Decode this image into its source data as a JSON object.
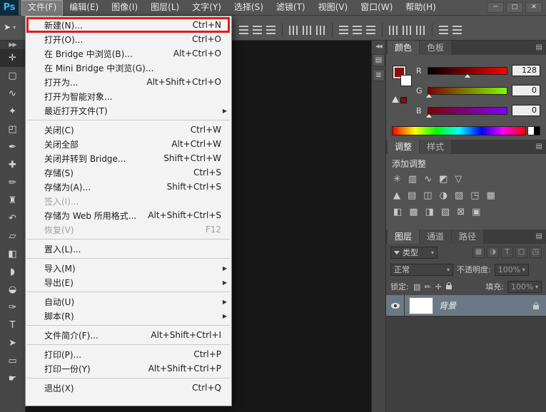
{
  "titlebar": {
    "logo_text": "Ps",
    "menus": [
      "文件(F)",
      "编辑(E)",
      "图像(I)",
      "图层(L)",
      "文字(Y)",
      "选择(S)",
      "滤镜(T)",
      "视图(V)",
      "窗口(W)",
      "帮助(H)"
    ],
    "active_menu_index": 0,
    "window_controls": [
      {
        "name": "minimize",
        "glyph": "─"
      },
      {
        "name": "maximize",
        "glyph": "▢"
      },
      {
        "name": "close",
        "glyph": "✕"
      }
    ]
  },
  "options_bar": {
    "tool_glyph": "➤",
    "dropdown_glyph": "▾",
    "groups": [
      {
        "icons": [
          "align-top-edges",
          "align-vertical-centers",
          "align-bottom-edges"
        ]
      },
      {
        "icons": [
          "align-left-edges",
          "align-horizontal-centers",
          "align-right-edges"
        ]
      },
      {
        "icons": [
          "distribute-top-edges",
          "distribute-vertical-centers",
          "distribute-bottom-edges"
        ]
      },
      {
        "icons": [
          "distribute-left-edges",
          "distribute-horizontal-centers",
          "distribute-right-edges"
        ]
      },
      {
        "icons": [
          "auto-align-layers",
          "3d-mode"
        ]
      }
    ]
  },
  "file_menu": {
    "items": [
      {
        "id": "new",
        "label": "新建(N)...",
        "shortcut": "Ctrl+N",
        "annotated": true
      },
      {
        "id": "open",
        "label": "打开(O)...",
        "shortcut": "Ctrl+O"
      },
      {
        "id": "browse-in-bridge",
        "label": "在 Bridge 中浏览(B)...",
        "shortcut": "Alt+Ctrl+O"
      },
      {
        "id": "browse-in-mini-bridge",
        "label": "在 Mini Bridge 中浏览(G)..."
      },
      {
        "id": "open-as",
        "label": "打开为...",
        "shortcut": "Alt+Shift+Ctrl+O"
      },
      {
        "id": "open-as-smart-object",
        "label": "打开为智能对象..."
      },
      {
        "id": "open-recent",
        "label": "最近打开文件(T)",
        "submenu": true,
        "separator_after": true
      },
      {
        "id": "close",
        "label": "关闭(C)",
        "shortcut": "Ctrl+W"
      },
      {
        "id": "close-all",
        "label": "关闭全部",
        "shortcut": "Alt+Ctrl+W"
      },
      {
        "id": "close-and-go-to-bridge",
        "label": "关闭并转到 Bridge...",
        "shortcut": "Shift+Ctrl+W"
      },
      {
        "id": "save",
        "label": "存储(S)",
        "shortcut": "Ctrl+S"
      },
      {
        "id": "save-as",
        "label": "存储为(A)...",
        "shortcut": "Shift+Ctrl+S"
      },
      {
        "id": "check-in",
        "label": "签入(I)...",
        "disabled": true
      },
      {
        "id": "save-for-web",
        "label": "存储为 Web 所用格式...",
        "shortcut": "Alt+Shift+Ctrl+S"
      },
      {
        "id": "revert",
        "label": "恢复(V)",
        "shortcut": "F12",
        "disabled": true,
        "separator_after": true
      },
      {
        "id": "place",
        "label": "置入(L)...",
        "separator_after": true
      },
      {
        "id": "import",
        "label": "导入(M)",
        "submenu": true
      },
      {
        "id": "export",
        "label": "导出(E)",
        "submenu": true,
        "separator_after": true
      },
      {
        "id": "automate",
        "label": "自动(U)",
        "submenu": true
      },
      {
        "id": "scripts",
        "label": "脚本(R)",
        "submenu": true,
        "separator_after": true
      },
      {
        "id": "file-info",
        "label": "文件简介(F)...",
        "shortcut": "Alt+Shift+Ctrl+I",
        "separator_after": true
      },
      {
        "id": "print",
        "label": "打印(P)...",
        "shortcut": "Ctrl+P"
      },
      {
        "id": "print-one-copy",
        "label": "打印一份(Y)",
        "shortcut": "Alt+Shift+Ctrl+P",
        "separator_after": true
      },
      {
        "id": "exit",
        "label": "退出(X)",
        "shortcut": "Ctrl+Q"
      }
    ]
  },
  "tools": [
    {
      "name": "move",
      "glyph": "✛",
      "selected": true
    },
    {
      "name": "rectangular-marquee",
      "glyph": "▢"
    },
    {
      "name": "lasso",
      "glyph": "∿"
    },
    {
      "name": "quick-selection",
      "glyph": "✦"
    },
    {
      "name": "crop",
      "glyph": "◰"
    },
    {
      "name": "eyedropper",
      "glyph": "✒"
    },
    {
      "name": "spot-healing-brush",
      "glyph": "✚"
    },
    {
      "name": "brush",
      "glyph": "✏"
    },
    {
      "name": "clone-stamp",
      "glyph": "♜"
    },
    {
      "name": "history-brush",
      "glyph": "↶"
    },
    {
      "name": "eraser",
      "glyph": "▱"
    },
    {
      "name": "gradient",
      "glyph": "◧"
    },
    {
      "name": "blur",
      "glyph": "◗"
    },
    {
      "name": "dodge",
      "glyph": "◒"
    },
    {
      "name": "pen",
      "glyph": "✑"
    },
    {
      "name": "horizontal-type",
      "glyph": "T"
    },
    {
      "name": "path-selection",
      "glyph": "➤"
    },
    {
      "name": "rectangle",
      "glyph": "▭"
    },
    {
      "name": "hand",
      "glyph": "☛"
    }
  ],
  "dock": {
    "collapse_glyph": "◀◀",
    "icons": [
      {
        "name": "history-panel",
        "glyph": "▤"
      },
      {
        "name": "properties-panel",
        "glyph": "≣"
      }
    ]
  },
  "color_panel": {
    "tabs": [
      "颜色",
      "色板"
    ],
    "foreground_color": "#8e0b0b",
    "background_color": "#ffffff",
    "channels": [
      {
        "label": "R",
        "value": "128",
        "pos": 50
      },
      {
        "label": "G",
        "value": "0",
        "pos": 1
      },
      {
        "label": "B",
        "value": "0",
        "pos": 1
      }
    ]
  },
  "adjustments_panel": {
    "tabs": [
      "调整",
      "样式"
    ],
    "title": "添加调整",
    "rows": [
      [
        {
          "name": "brightness-contrast",
          "glyph": "✳"
        },
        {
          "name": "levels",
          "glyph": "▥"
        },
        {
          "name": "curves",
          "glyph": "∿"
        },
        {
          "name": "exposure",
          "glyph": "◩"
        },
        {
          "name": "expand",
          "glyph": "▽"
        }
      ],
      [
        {
          "name": "vibrance",
          "glyph": "▲"
        },
        {
          "name": "hue-saturation",
          "glyph": "▤"
        },
        {
          "name": "color-balance",
          "glyph": "◫"
        },
        {
          "name": "black-white",
          "glyph": "◑"
        },
        {
          "name": "photo-filter",
          "glyph": "▨"
        },
        {
          "name": "channel-mixer",
          "glyph": "◳"
        },
        {
          "name": "color-lookup",
          "glyph": "▦"
        }
      ],
      [
        {
          "name": "invert",
          "glyph": "◧"
        },
        {
          "name": "posterize",
          "glyph": "▩"
        },
        {
          "name": "threshold",
          "glyph": "◨"
        },
        {
          "name": "gradient-map",
          "glyph": "▧"
        },
        {
          "name": "selective-color",
          "glyph": "⊠"
        },
        {
          "name": "mask",
          "glyph": "▣"
        }
      ]
    ]
  },
  "layers_panel": {
    "tabs": [
      "图层",
      "通道",
      "路径"
    ],
    "filter_label": "类型",
    "filter_icons": [
      {
        "name": "filter-pixel-layers",
        "glyph": "▦"
      },
      {
        "name": "filter-adjustment-layers",
        "glyph": "◑"
      },
      {
        "name": "filter-type-layers",
        "glyph": "T"
      },
      {
        "name": "filter-shape-layers",
        "glyph": "▢"
      },
      {
        "name": "filter-smart-objects",
        "glyph": "◳"
      }
    ],
    "blend_mode": "正常",
    "opacity_label": "不透明度:",
    "opacity_value": "100%",
    "lock_label": "锁定:",
    "lock_icons": [
      {
        "name": "lock-transparent-pixels",
        "glyph": "▨"
      },
      {
        "name": "lock-image-pixels",
        "glyph": "✏"
      },
      {
        "name": "lock-position",
        "glyph": "✛"
      },
      {
        "name": "lock-all",
        "css": "padlock"
      }
    ],
    "fill_label": "填充:",
    "fill_value": "100%",
    "layers": [
      {
        "name": "背景",
        "visible": true,
        "locked": true,
        "selected": true
      }
    ]
  }
}
